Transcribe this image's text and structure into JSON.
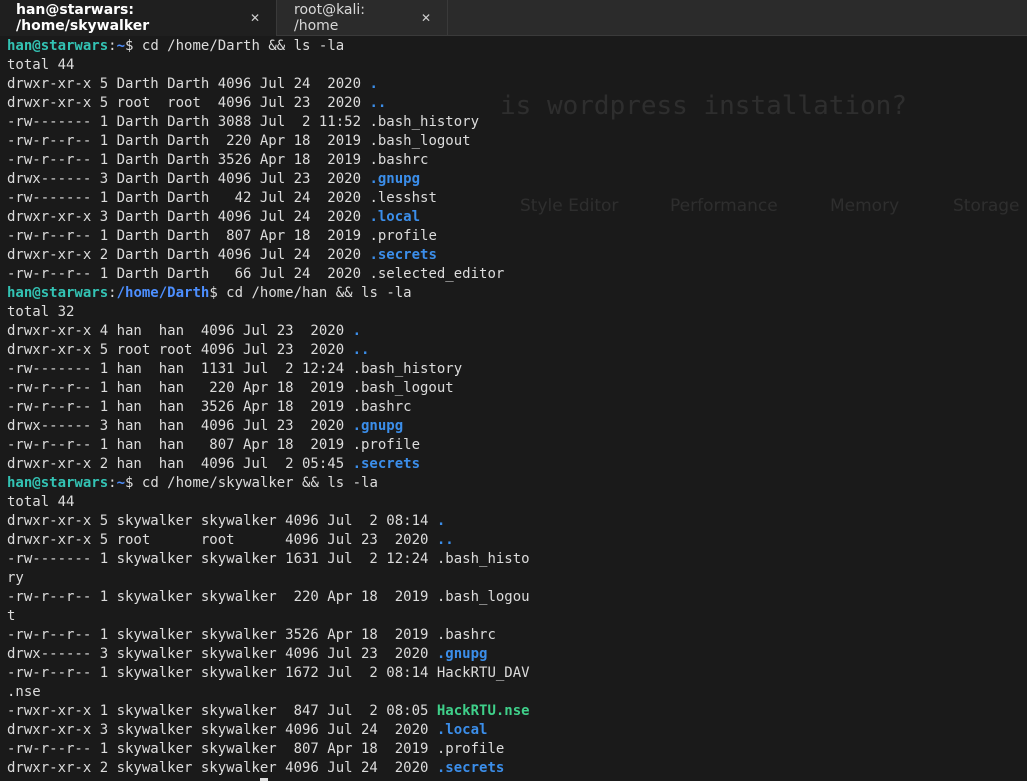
{
  "tabs": [
    {
      "title": "han@starwars: /home/skywalker",
      "close": "✕"
    },
    {
      "title": "root@kali: /home",
      "close": "✕"
    }
  ],
  "ghost": {
    "heading": "is wordpress installation?",
    "toolbar": [
      "Style Editor",
      "Performance",
      "Memory",
      "Storage"
    ]
  },
  "terminal": {
    "lines": [
      {
        "type": "prompt",
        "user": "han@starwars",
        "path": "~",
        "cmd": " cd /home/Darth && ls -la"
      },
      {
        "type": "text",
        "text": "total 44"
      },
      {
        "type": "entry",
        "meta": "drwxr-xr-x 5 Darth Darth 4096 Jul 24  2020 ",
        "name": ".",
        "kind": "dir"
      },
      {
        "type": "entry",
        "meta": "drwxr-xr-x 5 root  root  4096 Jul 23  2020 ",
        "name": "..",
        "kind": "dir"
      },
      {
        "type": "entry",
        "meta": "-rw------- 1 Darth Darth 3088 Jul  2 11:52 ",
        "name": ".bash_history",
        "kind": "file"
      },
      {
        "type": "entry",
        "meta": "-rw-r--r-- 1 Darth Darth  220 Apr 18  2019 ",
        "name": ".bash_logout",
        "kind": "file"
      },
      {
        "type": "entry",
        "meta": "-rw-r--r-- 1 Darth Darth 3526 Apr 18  2019 ",
        "name": ".bashrc",
        "kind": "file"
      },
      {
        "type": "entry",
        "meta": "drwx------ 3 Darth Darth 4096 Jul 23  2020 ",
        "name": ".gnupg",
        "kind": "dir"
      },
      {
        "type": "entry",
        "meta": "-rw------- 1 Darth Darth   42 Jul 24  2020 ",
        "name": ".lesshst",
        "kind": "file"
      },
      {
        "type": "entry",
        "meta": "drwxr-xr-x 3 Darth Darth 4096 Jul 24  2020 ",
        "name": ".local",
        "kind": "dir"
      },
      {
        "type": "entry",
        "meta": "-rw-r--r-- 1 Darth Darth  807 Apr 18  2019 ",
        "name": ".profile",
        "kind": "file"
      },
      {
        "type": "entry",
        "meta": "drwxr-xr-x 2 Darth Darth 4096 Jul 24  2020 ",
        "name": ".secrets",
        "kind": "dir"
      },
      {
        "type": "entry",
        "meta": "-rw-r--r-- 1 Darth Darth   66 Jul 24  2020 ",
        "name": ".selected_editor",
        "kind": "file"
      },
      {
        "type": "prompt",
        "user": "han@starwars",
        "path": "/home/Darth",
        "cmd": " cd /home/han && ls -la"
      },
      {
        "type": "text",
        "text": "total 32"
      },
      {
        "type": "entry",
        "meta": "drwxr-xr-x 4 han  han  4096 Jul 23  2020 ",
        "name": ".",
        "kind": "dir"
      },
      {
        "type": "entry",
        "meta": "drwxr-xr-x 5 root root 4096 Jul 23  2020 ",
        "name": "..",
        "kind": "dir"
      },
      {
        "type": "entry",
        "meta": "-rw------- 1 han  han  1131 Jul  2 12:24 ",
        "name": ".bash_history",
        "kind": "file"
      },
      {
        "type": "entry",
        "meta": "-rw-r--r-- 1 han  han   220 Apr 18  2019 ",
        "name": ".bash_logout",
        "kind": "file"
      },
      {
        "type": "entry",
        "meta": "-rw-r--r-- 1 han  han  3526 Apr 18  2019 ",
        "name": ".bashrc",
        "kind": "file"
      },
      {
        "type": "entry",
        "meta": "drwx------ 3 han  han  4096 Jul 23  2020 ",
        "name": ".gnupg",
        "kind": "dir"
      },
      {
        "type": "entry",
        "meta": "-rw-r--r-- 1 han  han   807 Apr 18  2019 ",
        "name": ".profile",
        "kind": "file"
      },
      {
        "type": "entry",
        "meta": "drwxr-xr-x 2 han  han  4096 Jul  2 05:45 ",
        "name": ".secrets",
        "kind": "dir"
      },
      {
        "type": "prompt",
        "user": "han@starwars",
        "path": "~",
        "cmd": " cd /home/skywalker && ls -la"
      },
      {
        "type": "text",
        "text": "total 44"
      },
      {
        "type": "entry",
        "meta": "drwxr-xr-x 5 skywalker skywalker 4096 Jul  2 08:14 ",
        "name": ".",
        "kind": "dir"
      },
      {
        "type": "entry",
        "meta": "drwxr-xr-x 5 root      root      4096 Jul 23  2020 ",
        "name": "..",
        "kind": "dir"
      },
      {
        "type": "entry",
        "meta": "-rw------- 1 skywalker skywalker 1631 Jul  2 12:24 ",
        "name": ".bash_histo",
        "kind": "file"
      },
      {
        "type": "text",
        "text": "ry"
      },
      {
        "type": "entry",
        "meta": "-rw-r--r-- 1 skywalker skywalker  220 Apr 18  2019 ",
        "name": ".bash_logou",
        "kind": "file"
      },
      {
        "type": "text",
        "text": "t"
      },
      {
        "type": "entry",
        "meta": "-rw-r--r-- 1 skywalker skywalker 3526 Apr 18  2019 ",
        "name": ".bashrc",
        "kind": "file"
      },
      {
        "type": "entry",
        "meta": "drwx------ 3 skywalker skywalker 4096 Jul 23  2020 ",
        "name": ".gnupg",
        "kind": "dir"
      },
      {
        "type": "entry",
        "meta": "-rw-r--r-- 1 skywalker skywalker 1672 Jul  2 08:14 ",
        "name": "HackRTU_DAV",
        "kind": "file"
      },
      {
        "type": "text",
        "text": ".nse"
      },
      {
        "type": "entry",
        "meta": "-rwxr-xr-x 1 skywalker skywalker  847 Jul  2 08:05 ",
        "name": "HackRTU.nse",
        "kind": "exec"
      },
      {
        "type": "entry",
        "meta": "drwxr-xr-x 3 skywalker skywalker 4096 Jul 24  2020 ",
        "name": ".local",
        "kind": "dir"
      },
      {
        "type": "entry",
        "meta": "-rw-r--r-- 1 skywalker skywalker  807 Apr 18  2019 ",
        "name": ".profile",
        "kind": "file"
      },
      {
        "type": "entry",
        "meta": "drwxr-xr-x 2 skywalker skywalker 4096 Jul 24  2020 ",
        "name": ".secrets",
        "kind": "dir"
      }
    ]
  },
  "colors": {
    "background": "#1a1a1a",
    "text": "#dcdcdc",
    "user": "#33c3b4",
    "path": "#4d8fff",
    "dir": "#3b8eea",
    "exec": "#3fd08a"
  }
}
